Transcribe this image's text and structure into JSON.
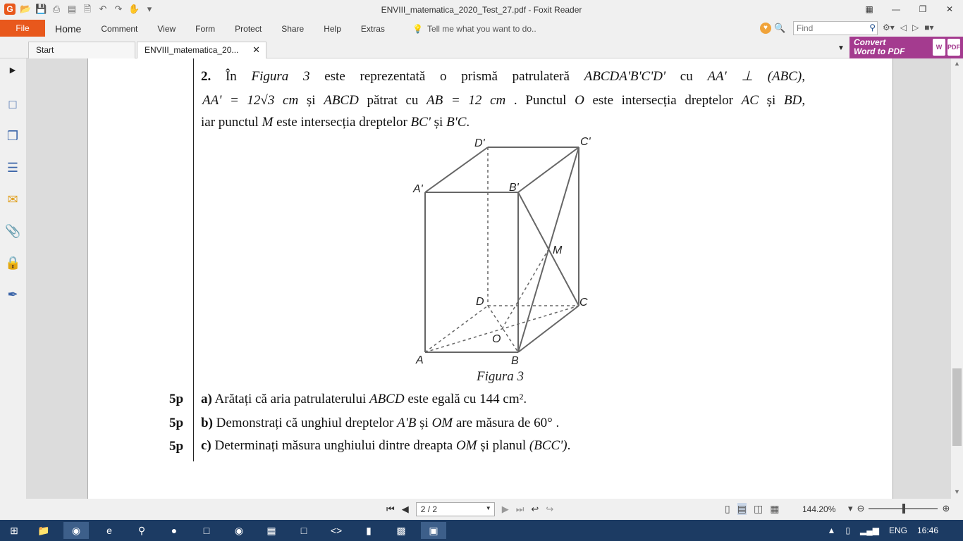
{
  "window": {
    "title": "ENVIII_matematica_2020_Test_27.pdf - Foxit Reader",
    "app_icon": "G"
  },
  "ribbon": {
    "file": "File",
    "tabs": [
      "Home",
      "Comment",
      "View",
      "Form",
      "Protect",
      "Share",
      "Help",
      "Extras"
    ],
    "tell_me": "Tell me what you want to do..",
    "find_placeholder": "Find"
  },
  "doc_tabs": {
    "start": "Start",
    "current": "ENVIII_matematica_20..."
  },
  "convert": {
    "line1": "Convert",
    "line2": "Word to PDF"
  },
  "problem": {
    "number": "2.",
    "line1": {
      "t1": "În",
      "fig": "Figura 3",
      "t2": "este reprezentată o prismă patrulateră",
      "prism": "ABCDA'B'C'D'",
      "t3": "cu",
      "perp": "AA' ⊥ (ABC),"
    },
    "line2": {
      "aa": "AA' = 12√3 cm",
      "t1": "și",
      "abcd": "ABCD",
      "t2": "pătrat cu",
      "ab": "AB = 12 cm",
      "t3": ". Punctul",
      "o": "O",
      "t4": "este intersecția dreptelor",
      "ac": "AC",
      "t5": "și",
      "bd": "BD",
      "t6": ","
    },
    "line3": {
      "t1": "iar punctul",
      "m": "M",
      "t2": "este intersecția dreptelor",
      "bc1": "BC'",
      "t3": "și",
      "b1c": "B'C",
      "t4": "."
    }
  },
  "figure": {
    "caption": "Figura 3",
    "labels": {
      "A": "A",
      "B": "B",
      "C": "C",
      "D": "D",
      "A1": "A'",
      "B1": "B'",
      "C1": "C'",
      "D1": "D'",
      "M": "M",
      "O": "O"
    }
  },
  "questions": [
    {
      "score": "5p",
      "letter": "a)",
      "text": "Arătați că aria patrulaterului",
      "math": "ABCD",
      "text2": "este egală cu",
      "math2": "144 cm²",
      "end": "."
    },
    {
      "score": "5p",
      "letter": "b)",
      "text": "Demonstrați că unghiul dreptelor",
      "math": "A'B",
      "text2": "și",
      "math2": "OM",
      "text3": "are măsura de",
      "math3": "60°",
      "end": "."
    },
    {
      "score": "5p",
      "letter": "c)",
      "text": "Determinați măsura unghiului dintre dreapta",
      "math": "OM",
      "text2": "și planul",
      "math2": "(BCC')",
      "end": "."
    }
  ],
  "status": {
    "page": "2 / 2",
    "zoom": "144.20%"
  },
  "taskbar": {
    "lang": "ENG",
    "time": "16:46"
  }
}
